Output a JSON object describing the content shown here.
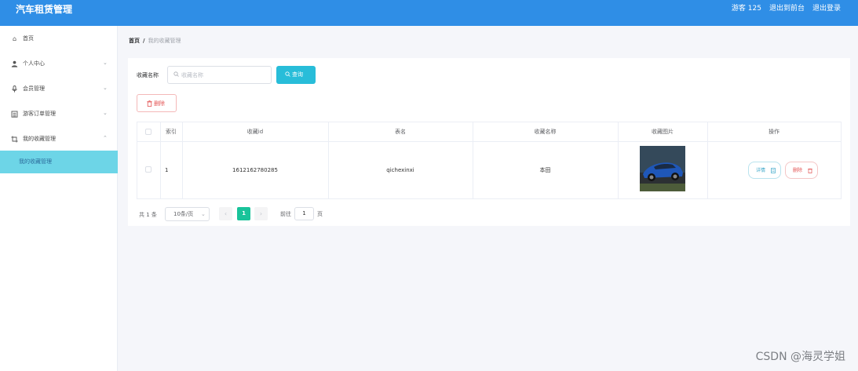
{
  "header": {
    "title": "汽车租赁管理",
    "user": "游客 125",
    "back_to_front": "退出到前台",
    "logout": "退出登录"
  },
  "sidebar": {
    "items": [
      {
        "label": "首页",
        "icon": "home-icon",
        "has_arrow": false
      },
      {
        "label": "个人中心",
        "icon": "user-icon",
        "arrow": "⌄"
      },
      {
        "label": "会员管理",
        "icon": "mic-icon",
        "arrow": "⌄"
      },
      {
        "label": "游客订单管理",
        "icon": "list-icon",
        "arrow": "⌄"
      },
      {
        "label": "我的收藏管理",
        "icon": "crop-icon",
        "arrow": "⌃"
      }
    ],
    "active_sub": "我的收藏管理"
  },
  "breadcrumb": {
    "home": "首页",
    "separator": "/",
    "current": "我的收藏管理"
  },
  "search": {
    "label": "收藏名称",
    "placeholder": "收藏名称",
    "button": "查询"
  },
  "actions": {
    "delete": "删除"
  },
  "table": {
    "headers": [
      "索引",
      "收藏id",
      "表名",
      "收藏名称",
      "收藏图片",
      "操作"
    ],
    "rows": [
      {
        "index": "1",
        "id": "1612162780285",
        "table_name": "qichexinxi",
        "name": "本田",
        "detail": "详情",
        "delete": "删除"
      }
    ]
  },
  "pagination": {
    "total": "共 1 条",
    "page_size": "10条/页",
    "current": "1",
    "goto": "前往",
    "goto_value": "1",
    "page_unit": "页"
  },
  "watermark": "CSDN @海灵学姐",
  "colors": {
    "topbar": "#2f8ee6",
    "active_menu": "#6dd5e7",
    "query_button": "#28bdd9",
    "danger": "#e35252",
    "pager_active": "#19c39a"
  }
}
